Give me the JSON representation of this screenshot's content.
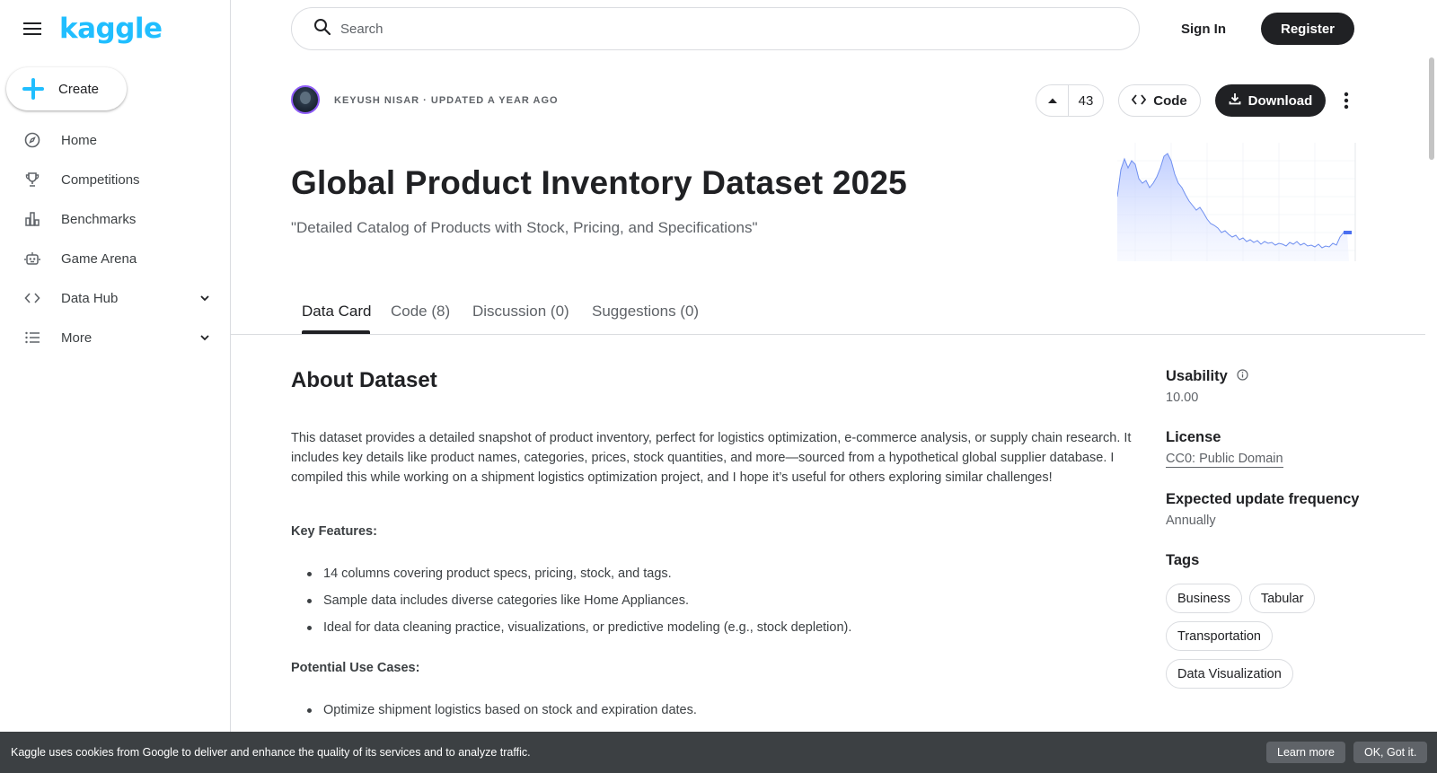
{
  "app": {
    "logo": "kaggle"
  },
  "sidebar": {
    "create_label": "Create",
    "items": [
      {
        "label": "Home",
        "icon": "compass-icon"
      },
      {
        "label": "Competitions",
        "icon": "trophy-icon"
      },
      {
        "label": "Benchmarks",
        "icon": "bar-chart-icon"
      },
      {
        "label": "Game Arena",
        "icon": "robot-icon"
      },
      {
        "label": "Data Hub",
        "icon": "code-icon",
        "expandable": true
      },
      {
        "label": "More",
        "icon": "list-icon",
        "expandable": true
      }
    ]
  },
  "topbar": {
    "search_placeholder": "Search",
    "signin_label": "Sign In",
    "register_label": "Register"
  },
  "dataset": {
    "byline": "KEYUSH NISAR · UPDATED A YEAR AGO",
    "upvotes": "43",
    "code_label": "Code",
    "download_label": "Download",
    "title": "Global Product Inventory Dataset 2025",
    "subtitle": "\"Detailed Catalog of Products with Stock, Pricing, and Specifications\""
  },
  "tabs": [
    {
      "label": "Data Card",
      "active": true
    },
    {
      "label": "Code (8)"
    },
    {
      "label": "Discussion (0)"
    },
    {
      "label": "Suggestions (0)"
    }
  ],
  "content": {
    "about_heading": "About Dataset",
    "description": "This dataset provides a detailed snapshot of product inventory, perfect for logistics optimization, e-commerce analysis, or supply chain research. It includes key details like product names, categories, prices, stock quantities, and more—sourced from a hypothetical global supplier database. I compiled this while working on a shipment logistics optimization project, and I hope it’s useful for others exploring similar challenges!",
    "key_features_heading": "Key Features:",
    "key_features": [
      "14 columns covering product specs, pricing, stock, and tags.",
      "Sample data includes diverse categories like Home Appliances.",
      "Ideal for data cleaning practice, visualizations, or predictive modeling (e.g., stock depletion)."
    ],
    "use_cases_heading": "Potential Use Cases:",
    "use_cases": [
      "Optimize shipment logistics based on stock and expiration dates."
    ]
  },
  "details": {
    "usability_label": "Usability",
    "usability_value": "10.00",
    "license_label": "License",
    "license_value": "CC0: Public Domain",
    "frequency_label": "Expected update frequency",
    "frequency_value": "Annually",
    "tags_label": "Tags",
    "tags": [
      "Business",
      "Tabular",
      "Transportation",
      "Data Visualization"
    ]
  },
  "cookie": {
    "text": "Kaggle uses cookies from Google to deliver and enhance the quality of its services and to analyze traffic.",
    "learn_more": "Learn more",
    "ok": "OK, Got it."
  },
  "colors": {
    "brand": "#20beff",
    "dark_button": "#202124",
    "cookie_bg": "#3c4043"
  }
}
